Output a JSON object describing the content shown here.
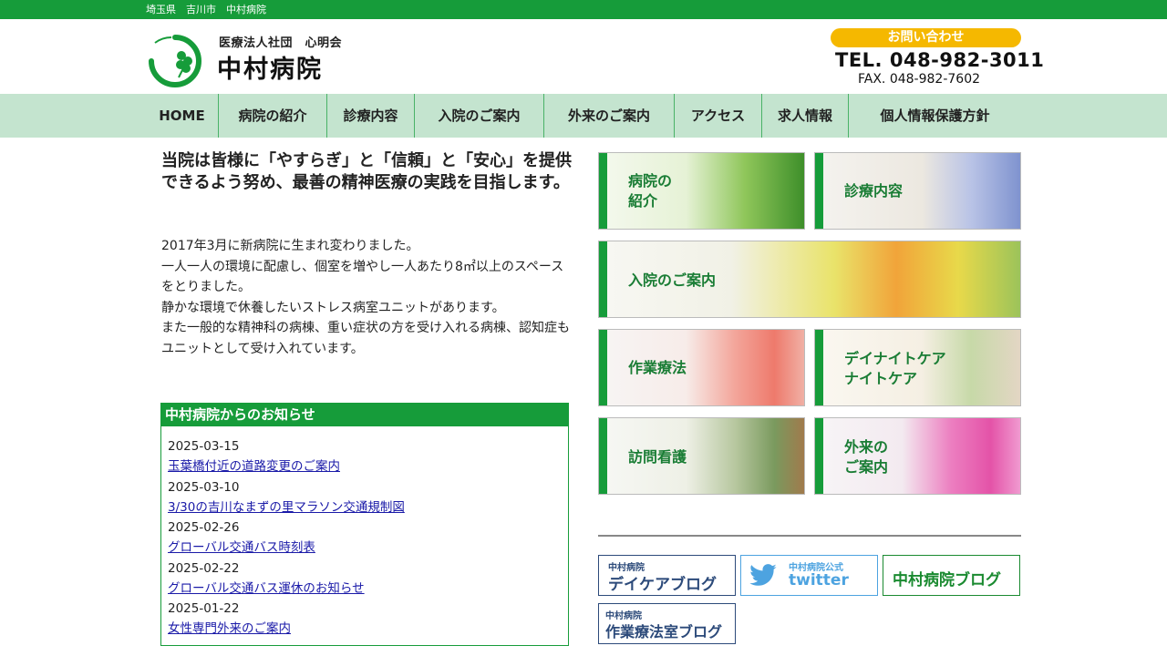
{
  "topbar": {
    "breadcrumb": "埼玉県　吉川市　中村病院"
  },
  "header": {
    "org": "医療法人社団　心明会",
    "name": "中村病院",
    "contact_label": "お問い合わせ",
    "tel": "TEL. 048-982-3011",
    "fax": "FAX. 048-982-7602"
  },
  "nav": [
    {
      "label": "HOME"
    },
    {
      "label": "病院の紹介"
    },
    {
      "label": "診療内容"
    },
    {
      "label": "入院のご案内"
    },
    {
      "label": "外来のご案内"
    },
    {
      "label": "アクセス"
    },
    {
      "label": "求人情報"
    },
    {
      "label": "個人情報保護方針"
    }
  ],
  "main": {
    "lead": "当院は皆様に「やすらぎ」と「信頼」と「安心」を提供できるよう努め、最善の精神医療の実践を目指します。",
    "intro": [
      "2017年3月に新病院に生まれ変わりました。",
      "一人一人の環境に配慮し、個室を増やし一人あたり8㎡以上のスペースをとりました。",
      "静かな環境で休養したいストレス病室ユニットがあります。",
      "また一般的な精神科の病棟、重い症状の方を受け入れる病棟、認知症もユニットとして受け入れています。"
    ]
  },
  "news": {
    "title": "中村病院からのお知らせ",
    "items": [
      {
        "date": "2025-03-15",
        "title": "玉葉橋付近の道路変更のご案内"
      },
      {
        "date": "2025-03-10",
        "title": "3/30の吉川なまずの里マラソン交通規制図"
      },
      {
        "date": "2025-02-26",
        "title": "グローバル交通バス時刻表"
      },
      {
        "date": "2025-02-22",
        "title": "グローバル交通バス運休のお知らせ"
      },
      {
        "date": "2025-01-22",
        "title": "女性専門外来のご案内"
      }
    ]
  },
  "tiles": [
    {
      "label1": "病院の",
      "label2": "紹介"
    },
    {
      "label1": "診療内容",
      "label2": ""
    },
    {
      "label1": "入院のご案内",
      "label2": ""
    },
    {
      "label1": "作業療法",
      "label2": ""
    },
    {
      "label1": "デイナイトケア",
      "label2": "ナイトケア"
    },
    {
      "label1": "訪問看護",
      "label2": ""
    },
    {
      "label1": "外来の",
      "label2": "ご案内"
    }
  ],
  "blogs": [
    {
      "small": "中村病院",
      "big": "デイケアブログ"
    },
    {
      "small": "中村病院公式",
      "big": "twitter"
    },
    {
      "small": "",
      "big": "中村病院ブログ"
    },
    {
      "small": "中村病院",
      "big": "作業療法室ブログ"
    }
  ],
  "colors": {
    "brand_green": "#169c3a",
    "nav_bg": "#c4e4cf",
    "contact_yellow": "#f5b800",
    "link": "#1a1aa8",
    "twitter": "#4da3e0"
  }
}
